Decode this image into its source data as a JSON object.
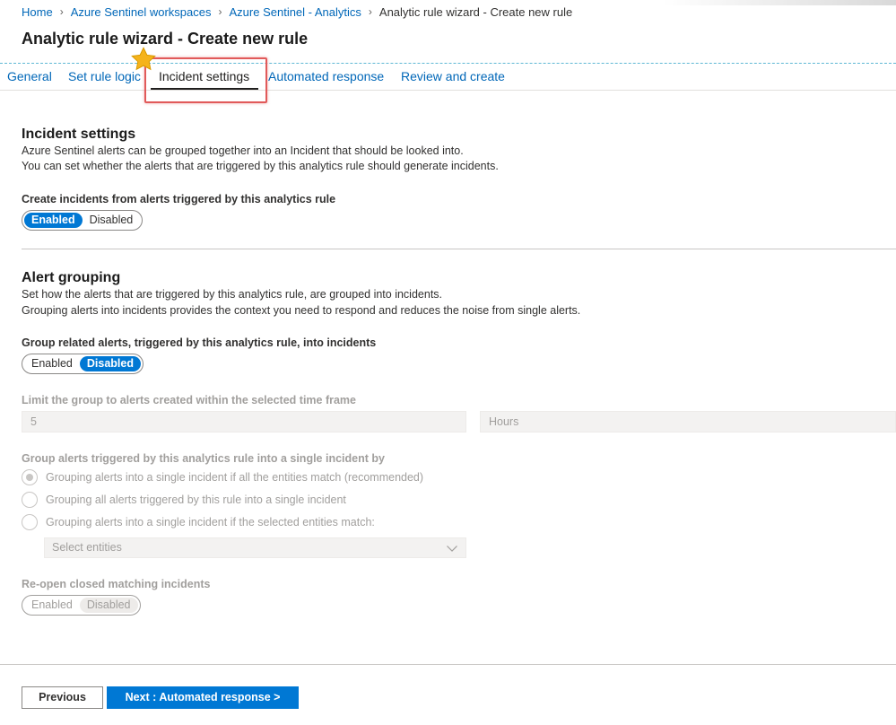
{
  "breadcrumb": {
    "items": [
      "Home",
      "Azure Sentinel workspaces",
      "Azure Sentinel - Analytics"
    ],
    "current": "Analytic rule wizard - Create new rule"
  },
  "page_title": "Analytic rule wizard - Create new rule",
  "tabs": [
    {
      "label": "General"
    },
    {
      "label": "Set rule logic"
    },
    {
      "label": "Incident settings"
    },
    {
      "label": "Automated response"
    },
    {
      "label": "Review and create"
    }
  ],
  "active_tab": "Incident settings",
  "incident_settings": {
    "title": "Incident settings",
    "desc1": "Azure Sentinel alerts can be grouped together into an Incident that should be looked into.",
    "desc2": "You can set whether the alerts that are triggered by this analytics rule should generate incidents.",
    "create_label": "Create incidents from alerts triggered by this analytics rule",
    "toggle": {
      "enabled": "Enabled",
      "disabled": "Disabled",
      "selected": "Enabled"
    }
  },
  "alert_grouping": {
    "title": "Alert grouping",
    "desc1": "Set how the alerts that are triggered by this analytics rule, are grouped into incidents.",
    "desc2": "Grouping alerts into incidents provides the context you need to respond and reduces the noise from single alerts.",
    "group_label": "Group related alerts, triggered by this analytics rule, into incidents",
    "toggle": {
      "enabled": "Enabled",
      "disabled": "Disabled",
      "selected": "Disabled"
    },
    "limit_label": "Limit the group to alerts created within the selected time frame",
    "limit_value": "5",
    "limit_unit": "Hours",
    "single_label": "Group alerts triggered by this analytics rule into a single incident by",
    "radios": [
      {
        "label": "Grouping alerts into a single incident if all the entities match (recommended)",
        "checked": true
      },
      {
        "label": "Grouping all alerts triggered by this rule into a single incident",
        "checked": false
      },
      {
        "label": "Grouping alerts into a single incident if the selected entities match:",
        "checked": false
      }
    ],
    "entities_placeholder": "Select entities",
    "reopen_label": "Re-open closed matching incidents",
    "reopen_toggle": {
      "enabled": "Enabled",
      "disabled": "Disabled",
      "selected": "Disabled"
    }
  },
  "footer": {
    "previous": "Previous",
    "next": "Next : Automated response >"
  },
  "colors": {
    "accent": "#0078d4",
    "link": "#0067b8",
    "highlight": "#e15a5a",
    "star": "#f5b31b"
  },
  "icons": [
    "star-icon",
    "chevron-right-icon",
    "chevron-down-icon"
  ]
}
